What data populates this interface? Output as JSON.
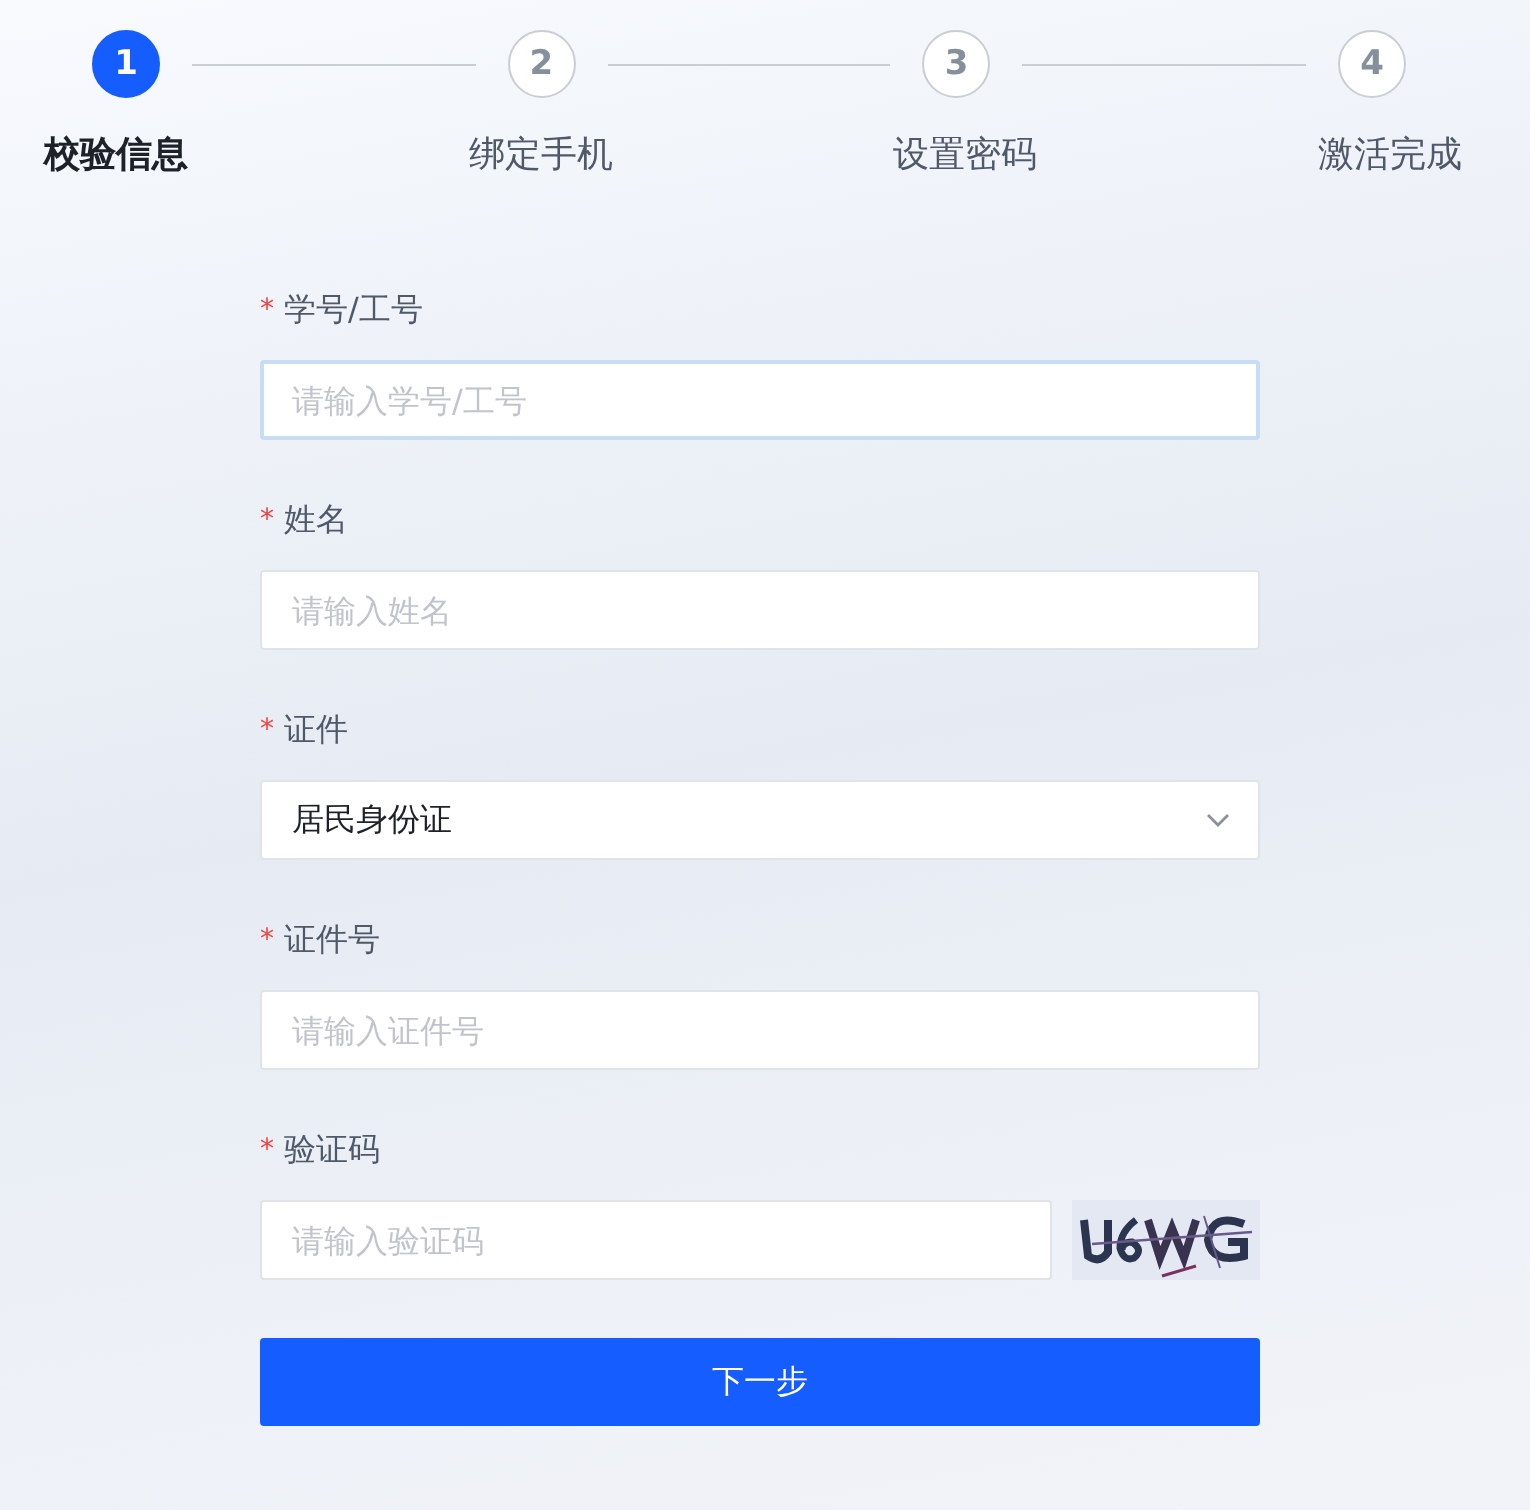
{
  "steps": [
    {
      "number": "1",
      "label": "校验信息",
      "selected": true
    },
    {
      "number": "2",
      "label": "绑定手机",
      "selected": false
    },
    {
      "number": "3",
      "label": "设置密码",
      "selected": false
    },
    {
      "number": "4",
      "label": "激活完成",
      "selected": false
    }
  ],
  "form": {
    "fields": [
      {
        "kind": "text",
        "required_mark": "*",
        "label": "学号/工号",
        "placeholder": "请输入学号/工号",
        "focused": true
      },
      {
        "kind": "text",
        "required_mark": "*",
        "label": "姓名",
        "placeholder": "请输入姓名",
        "focused": false
      },
      {
        "kind": "select",
        "required_mark": "*",
        "label": "证件",
        "value": "居民身份证"
      },
      {
        "kind": "text",
        "required_mark": "*",
        "label": "证件号",
        "placeholder": "请输入证件号",
        "focused": false
      },
      {
        "kind": "captcha",
        "required_mark": "*",
        "label": "验证码",
        "placeholder": "请输入验证码",
        "focused": false
      }
    ],
    "submit": "下一步"
  }
}
